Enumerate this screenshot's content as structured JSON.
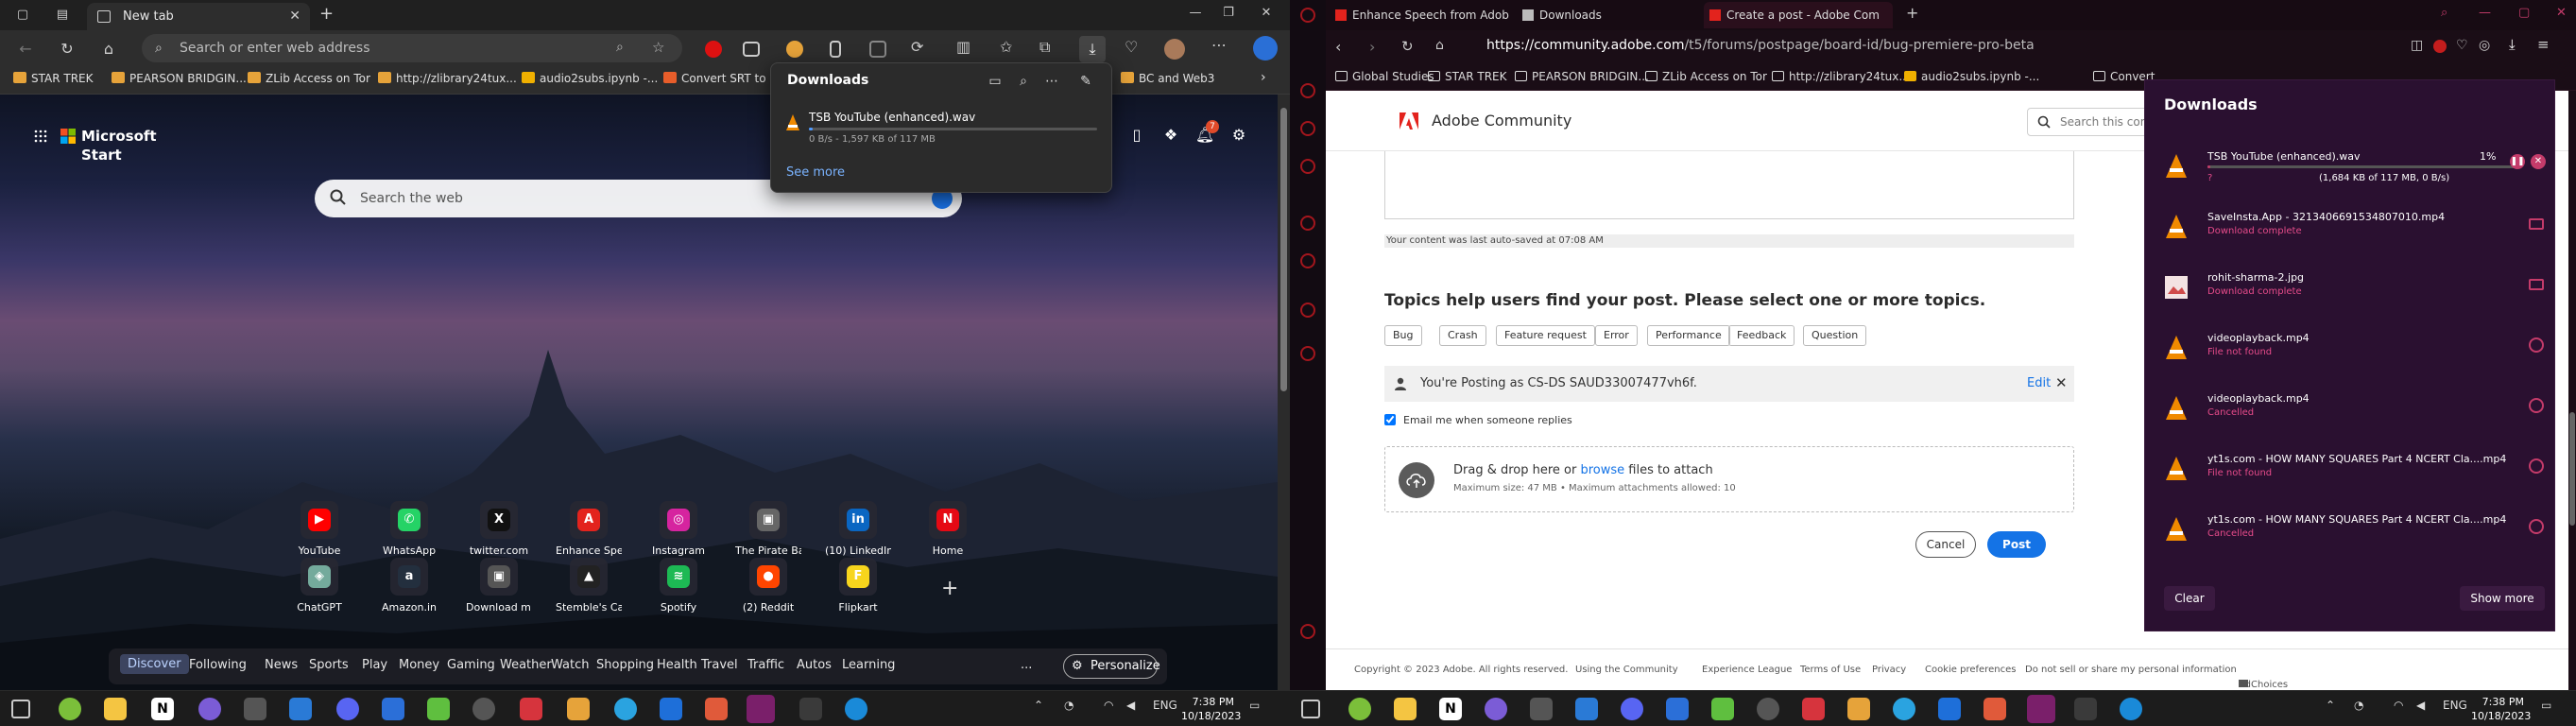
{
  "edge": {
    "tab_title": "New tab",
    "url_placeholder": "Search or enter web address",
    "bookmarks": [
      {
        "label": "STAR TREK",
        "color": "#e6a33a"
      },
      {
        "label": "PEARSON BRIDGIN...",
        "color": "#e6a33a"
      },
      {
        "label": "ZLib Access on Tor",
        "color": "#e6a33a"
      },
      {
        "label": "http://zlibrary24tux...",
        "color": "#e6a33a"
      },
      {
        "label": "audio2subs.ipynb -...",
        "color": "#f0b000"
      },
      {
        "label": "Convert SRT to Pl...",
        "color": "#e85d2a"
      },
      {
        "label": "BC and Web3",
        "color": "#e6a33a"
      }
    ],
    "ms_start_label": "Microsoft Start",
    "search_placeholder": "Search the web",
    "notification_count": "7",
    "tiles_row1": [
      {
        "label": "YouTube",
        "glyph": "▶",
        "color": "#ff0000"
      },
      {
        "label": "WhatsApp",
        "glyph": "✆",
        "color": "#25d366"
      },
      {
        "label": "twitter.com",
        "glyph": "X",
        "color": "#111111"
      },
      {
        "label": "Enhance Spe...",
        "glyph": "A",
        "color": "#e3231d"
      },
      {
        "label": "Instagram",
        "glyph": "◎",
        "color": "#d6249f"
      },
      {
        "label": "The Pirate Bay",
        "glyph": "▣",
        "color": "#666666"
      },
      {
        "label": "(10) LinkedIn",
        "glyph": "in",
        "color": "#0a66c2"
      },
      {
        "label": "Home",
        "glyph": "N",
        "color": "#e50914"
      }
    ],
    "tiles_row2": [
      {
        "label": "ChatGPT",
        "glyph": "◈",
        "color": "#74aa9c"
      },
      {
        "label": "Amazon.in",
        "glyph": "a",
        "color": "#232f3e"
      },
      {
        "label": "Download m...",
        "glyph": "▣",
        "color": "#555555"
      },
      {
        "label": "Stemble's Ca...",
        "glyph": "▲",
        "color": "#222222"
      },
      {
        "label": "Spotify",
        "glyph": "≋",
        "color": "#1db954"
      },
      {
        "label": "(2) Reddit",
        "glyph": "●",
        "color": "#ff4500"
      },
      {
        "label": "Flipkart",
        "glyph": "F",
        "color": "#f7d51d"
      }
    ],
    "feed_tabs": [
      "Discover",
      "Following",
      "News",
      "Sports",
      "Play",
      "Money",
      "Gaming",
      "Weather",
      "Watch",
      "Shopping",
      "Health",
      "Travel",
      "Traffic",
      "Autos",
      "Learning"
    ],
    "feed_more": "...",
    "personalize_label": "Personalize",
    "downloads": {
      "title": "Downloads",
      "item_name": "TSB YouTube (enhanced).wav",
      "item_status": "0 B/s - 1,597 KB of 117 MB",
      "progress": 0.014,
      "see_more": "See more"
    }
  },
  "taskbar_left": {
    "lang": "ENG",
    "time": "7:38 PM",
    "date": "10/18/2023"
  },
  "opera": {
    "tabs": [
      {
        "title": "Enhance Speech from Adob",
        "icon_color": "#e3231d"
      },
      {
        "title": "Downloads",
        "icon_color": "#bbbbbb"
      },
      {
        "title": "Create a post - Adobe Com",
        "icon_color": "#e3231d"
      }
    ],
    "url_host": "https://community.adobe.com",
    "url_path": "/t5/forums/postpage/board-id/bug-premiere-pro-beta",
    "bookmarks": [
      {
        "label": "Global Studies",
        "color": "#dddddd"
      },
      {
        "label": "STAR TREK",
        "color": "#dddddd"
      },
      {
        "label": "PEARSON BRIDGIN...",
        "color": "#dddddd"
      },
      {
        "label": "ZLib Access on Tor",
        "color": "#dddddd"
      },
      {
        "label": "http://zlibrary24tux...",
        "color": "#dddddd"
      },
      {
        "label": "audio2subs.ipynb -...",
        "color": "#f0b000"
      },
      {
        "label": "Convert",
        "color": "#dddddd"
      }
    ],
    "page": {
      "site_title": "Adobe Community",
      "search_placeholder": "Search this community",
      "autosave": "Your content was last auto-saved at 07:08 AM",
      "topics_heading": "Topics help users find your post. Please select one or more topics.",
      "topics": [
        "Bug",
        "Crash",
        "Feature request",
        "Error",
        "Performance",
        "Feedback",
        "Question"
      ],
      "posting_as": "You're Posting as CS-DS SAUD33007477vh6f.",
      "edit_label": "Edit",
      "email_me": "Email me when someone replies",
      "drop_text_pre": "Drag & drop here or ",
      "drop_link": "browse",
      "drop_text_post": " files to attach",
      "drop_sub": "Maximum size: 47 MB • Maximum attachments allowed: 10",
      "cancel_label": "Cancel",
      "post_label": "Post",
      "footer": [
        "Copyright © 2023 Adobe. All rights reserved.",
        "Using the Community",
        "Experience League",
        "Terms of Use",
        "Privacy",
        "Cookie preferences",
        "Do not sell or share my personal information",
        "AdChoices"
      ]
    },
    "downloads": {
      "title": "Downloads",
      "items": [
        {
          "name": "TSB YouTube (enhanced).wav",
          "status": "(1,684 KB of 117 MB, 0 B/s)",
          "percent": "1%",
          "progress": 0.01,
          "kind": "vlc",
          "extra": "?"
        },
        {
          "name": "SaveInsta.App - 3213406691534807010.mp4",
          "status": "Download complete",
          "kind": "vlc"
        },
        {
          "name": "rohit-sharma-2.jpg",
          "status": "Download complete",
          "kind": "image"
        },
        {
          "name": "videoplayback.mp4",
          "status": "File not found",
          "kind": "vlc"
        },
        {
          "name": "videoplayback.mp4",
          "status": "Cancelled",
          "kind": "vlc"
        },
        {
          "name": "yt1s.com - HOW MANY SQUARES  Part 4  NCERT Cla....mp4",
          "status": "File not found",
          "kind": "vlc"
        },
        {
          "name": "yt1s.com - HOW MANY SQUARES  Part 4  NCERT Cla....mp4",
          "status": "Cancelled",
          "kind": "vlc"
        }
      ],
      "clear_label": "Clear",
      "show_more_label": "Show more"
    }
  },
  "taskbar_right": {
    "lang": "ENG",
    "time": "7:38 PM",
    "date": "10/18/2023"
  }
}
